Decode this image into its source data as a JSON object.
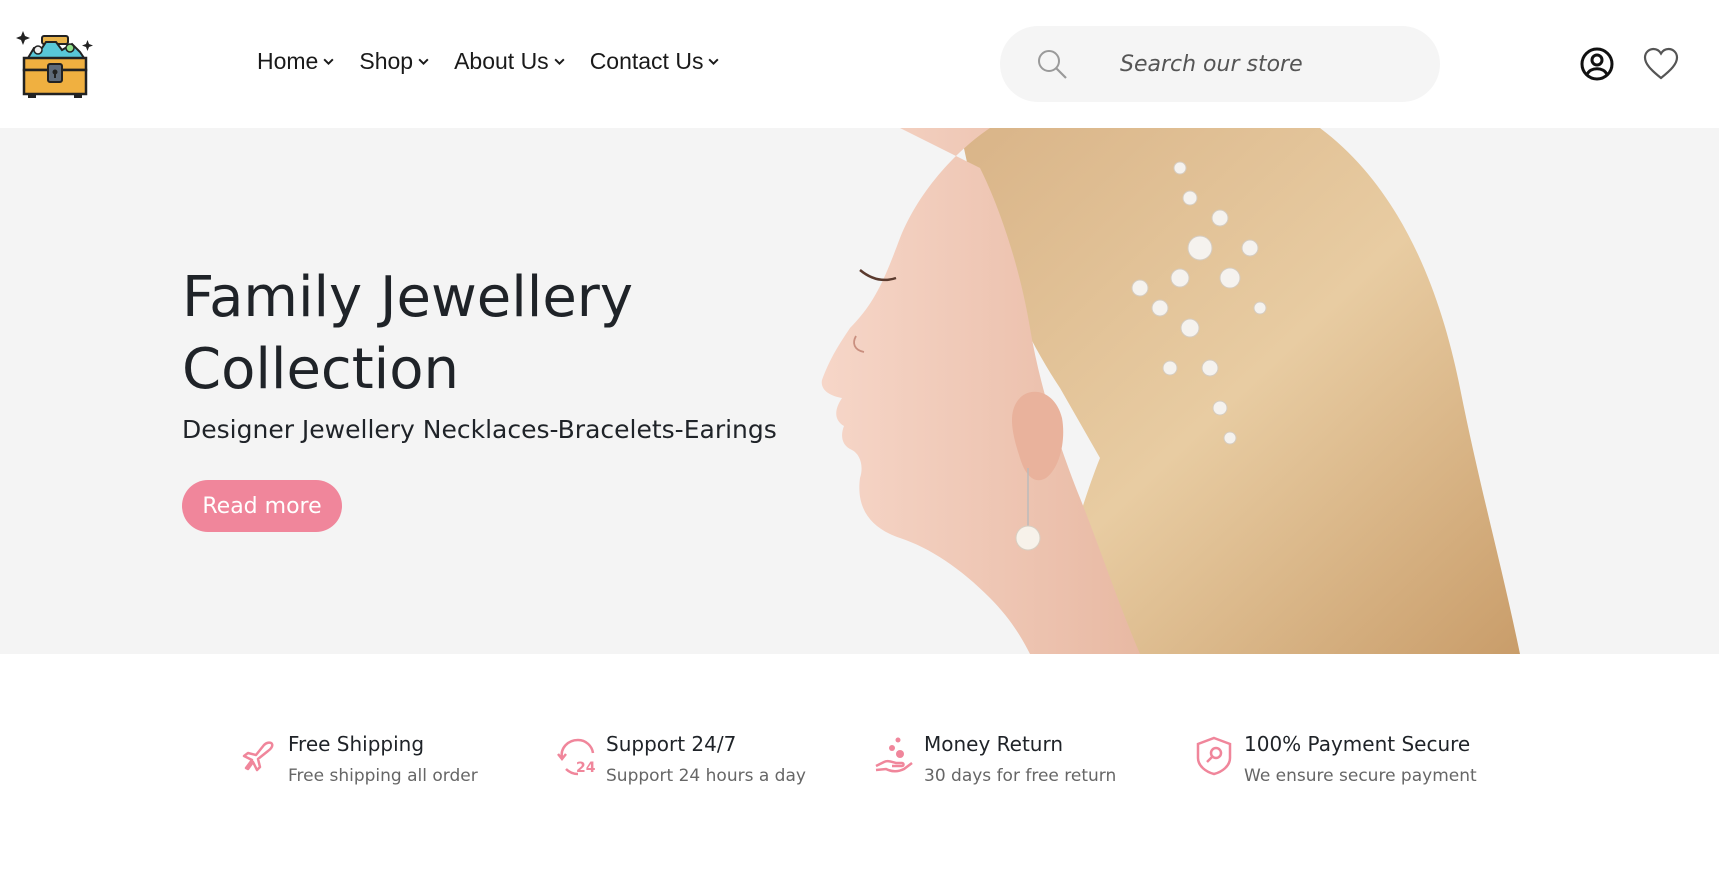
{
  "header": {
    "nav": [
      {
        "label": "Home"
      },
      {
        "label": "Shop"
      },
      {
        "label": "About Us"
      },
      {
        "label": "Contact Us"
      }
    ],
    "search": {
      "placeholder": "Search our store"
    }
  },
  "hero": {
    "title": "Family Jewellery Collection",
    "subtitle": "Designer Jewellery Necklaces-Bracelets-Earings",
    "button_label": "Read more"
  },
  "features": [
    {
      "title": "Free Shipping",
      "desc": "Free shipping all order",
      "icon": "airplane-icon"
    },
    {
      "title": "Support 24/7",
      "desc": "Support 24 hours a day",
      "icon": "support-24-icon"
    },
    {
      "title": "Money Return",
      "desc": "30 days for free return",
      "icon": "money-return-icon"
    },
    {
      "title": "100% Payment Secure",
      "desc": "We ensure secure payment",
      "icon": "secure-payment-icon"
    }
  ],
  "colors": {
    "accent": "#f0869b",
    "hero_bg": "#f4f4f4",
    "search_bg": "#f5f5f5"
  }
}
